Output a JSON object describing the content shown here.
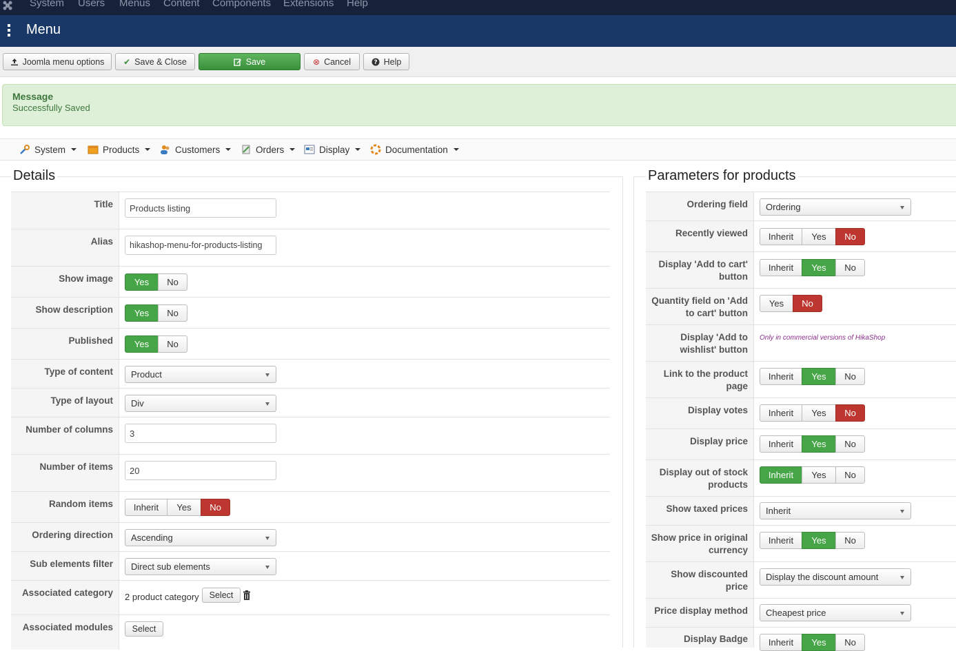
{
  "topnav": {
    "items": [
      "System",
      "Users",
      "Menus",
      "Content",
      "Components",
      "Extensions",
      "Help"
    ]
  },
  "header": {
    "title": "Menu"
  },
  "toolbar": {
    "joomla_options": "Joomla menu options",
    "save_close": "Save & Close",
    "save": "Save",
    "cancel": "Cancel",
    "help": "Help"
  },
  "message": {
    "title": "Message",
    "text": "Successfully Saved"
  },
  "subnav": {
    "items": [
      "System",
      "Products",
      "Customers",
      "Orders",
      "Display",
      "Documentation"
    ]
  },
  "details": {
    "legend": "Details",
    "title_label": "Title",
    "title_value": "Products listing",
    "alias_label": "Alias",
    "alias_value": "hikashop-menu-for-products-listing",
    "show_image_label": "Show image",
    "show_description_label": "Show description",
    "published_label": "Published",
    "type_content_label": "Type of content",
    "type_content_value": "Product",
    "type_layout_label": "Type of layout",
    "type_layout_value": "Div",
    "num_columns_label": "Number of columns",
    "num_columns_value": "3",
    "num_items_label": "Number of items",
    "num_items_value": "20",
    "random_items_label": "Random items",
    "ordering_direction_label": "Ordering direction",
    "ordering_direction_value": "Ascending",
    "sub_elements_label": "Sub elements filter",
    "sub_elements_value": "Direct sub elements",
    "assoc_category_label": "Associated category",
    "assoc_category_value": "2 product category",
    "assoc_modules_label": "Associated modules",
    "select_label": "Select",
    "yes": "Yes",
    "no": "No",
    "inherit": "Inherit"
  },
  "params": {
    "legend": "Parameters for products",
    "ordering_field_label": "Ordering field",
    "ordering_field_value": "Ordering",
    "recently_viewed_label": "Recently viewed",
    "add_to_cart_label": "Display 'Add to cart' button",
    "quantity_field_label": "Quantity field on 'Add to cart' button",
    "wishlist_label": "Display 'Add to wishlist' button",
    "wishlist_note": "Only in commercial versions of HikaShop",
    "link_product_label": "Link to the product page",
    "display_votes_label": "Display votes",
    "display_price_label": "Display price",
    "out_of_stock_label": "Display out of stock products",
    "taxed_prices_label": "Show taxed prices",
    "taxed_prices_value": "Inherit",
    "original_currency_label": "Show price in original currency",
    "discounted_price_label": "Show discounted price",
    "discounted_price_value": "Display the discount amount",
    "price_method_label": "Price display method",
    "price_method_value": "Cheapest price",
    "display_badge_label": "Display Badge",
    "yes": "Yes",
    "no": "No",
    "inherit": "Inherit"
  },
  "colors": {
    "green": "#46a546",
    "red": "#bd362f",
    "header_bg": "#1a3867",
    "topnav_bg": "#17223a"
  }
}
